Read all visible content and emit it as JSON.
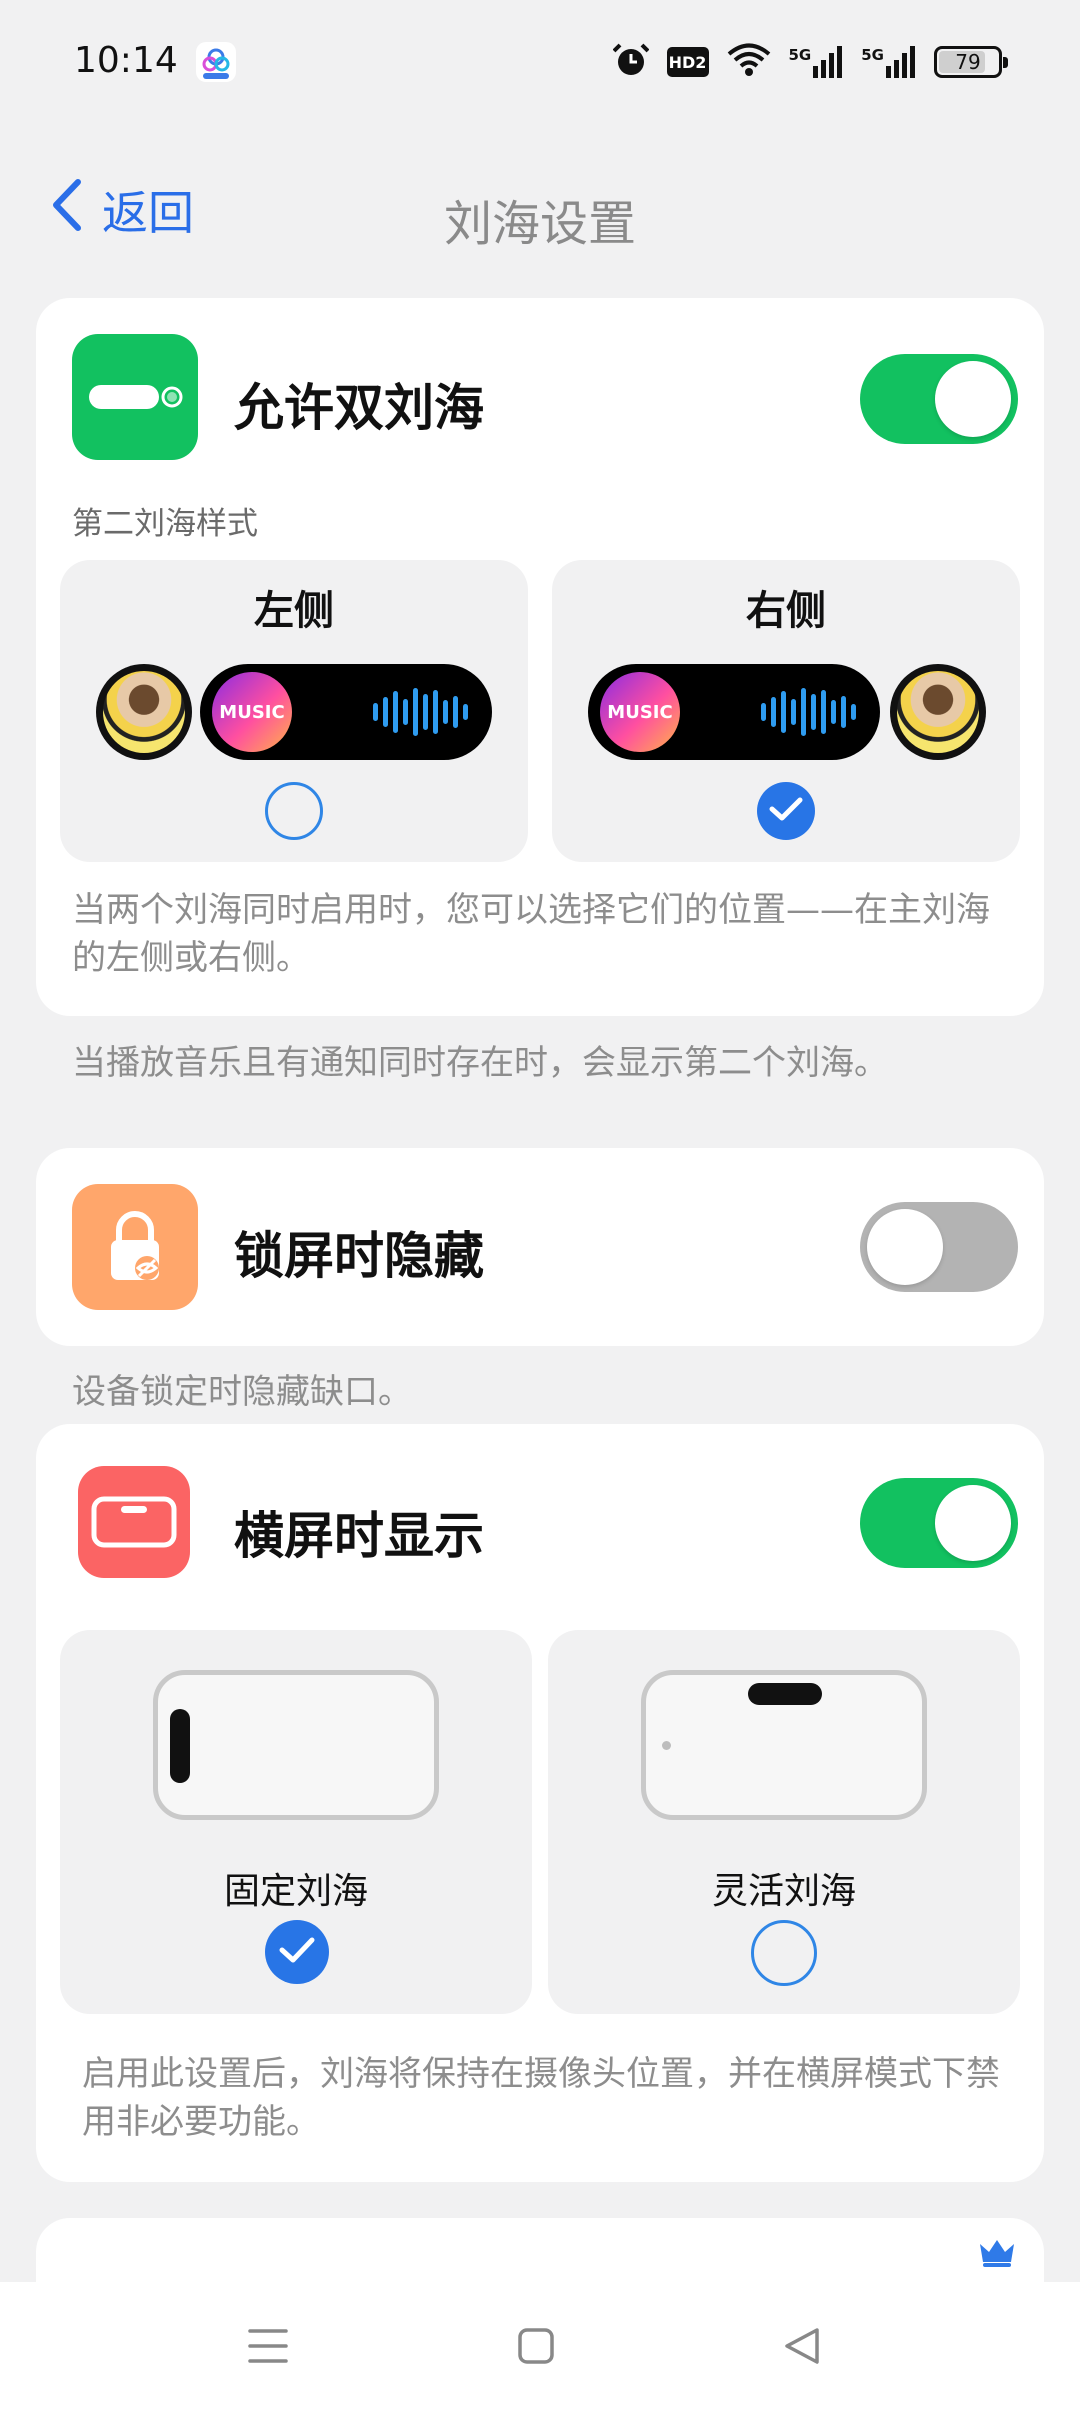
{
  "status_bar": {
    "time": "10:14",
    "hd_label": "HD2",
    "signal_label_1": "5G",
    "signal_label_2": "5G",
    "battery": "79",
    "battery_level": 0.79
  },
  "header": {
    "back_label": "返回",
    "title": "刘海设置"
  },
  "dual_notch": {
    "title": "允许双刘海",
    "enabled": true,
    "icon": "pill-icon",
    "icon_color": "#12c160",
    "style_heading": "第二刘海样式",
    "options": [
      {
        "label": "左侧",
        "selected": false
      },
      {
        "label": "右侧",
        "selected": true
      }
    ],
    "album_text": "MUSIC",
    "description": "当两个刘海同时启用时，您可以选择它们的位置——在主刘海的左侧或右侧。",
    "footnote": "当播放音乐且有通知同时存在时，会显示第二个刘海。"
  },
  "lock_screen": {
    "title": "锁屏时隐藏",
    "enabled": false,
    "icon": "lock-hidden-icon",
    "icon_color": "#ffa66b",
    "footnote": "设备锁定时隐藏缺口。"
  },
  "landscape": {
    "title": "横屏时显示",
    "enabled": true,
    "icon": "landscape-phone-icon",
    "icon_color": "#fb6464",
    "options": [
      {
        "label": "固定刘海",
        "selected": true
      },
      {
        "label": "灵活刘海",
        "selected": false
      }
    ],
    "description": "启用此设置后，刘海将保持在摄像头位置，并在横屏模式下禁用非必要功能。"
  },
  "next_card": {
    "icon": "crown-icon",
    "accent": "#2f7ae8"
  },
  "accent_color": "#2a6ee8",
  "toggle_on_color": "#12c160"
}
